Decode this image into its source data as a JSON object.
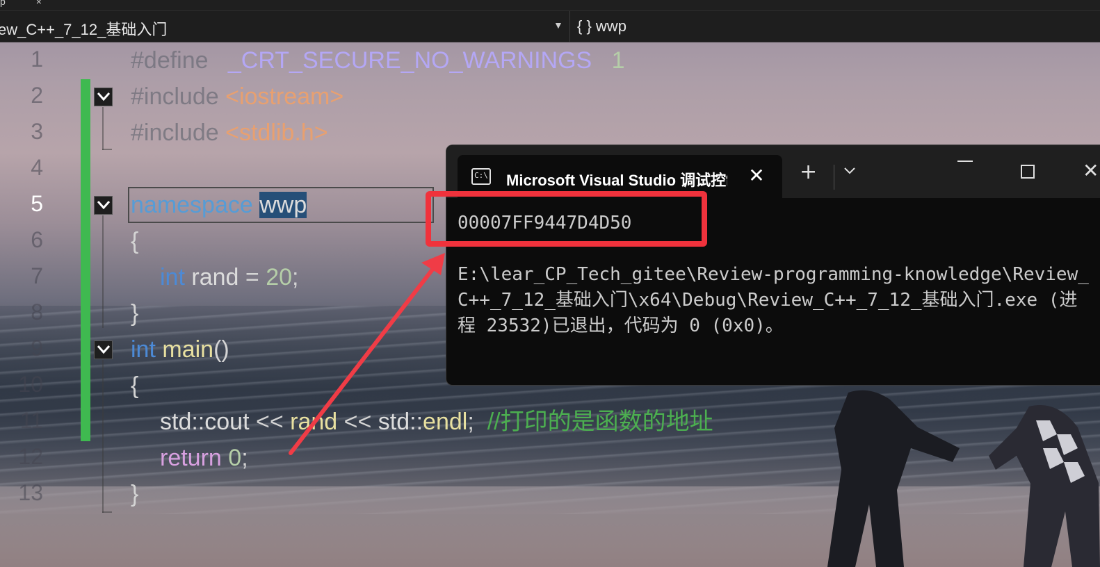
{
  "window": {
    "tab_fragment": "p",
    "tab_close": "×"
  },
  "navbar": {
    "project_dropdown": "ew_C++_7_12_基础入门",
    "scope": "{ } wwp"
  },
  "editor": {
    "line_numbers": [
      "1",
      "2",
      "3",
      "4",
      "5",
      "6",
      "7",
      "8",
      "9",
      "10",
      "11",
      "12",
      "13"
    ],
    "active_line": "5",
    "lines": {
      "l1": {
        "kw": "#define",
        "macro": "_CRT_SECURE_NO_WARNINGS",
        "num": "1"
      },
      "l2": {
        "kw": "#include",
        "lt": "<",
        "name": "iostream",
        "gt": ">"
      },
      "l3": {
        "kw": "#include",
        "lt": "<",
        "name": "stdlib.h",
        "gt": ">"
      },
      "l5": {
        "kw": "namespace",
        "name": "wwp"
      },
      "l6": {
        "text": "{"
      },
      "l7": {
        "type": "int",
        "name": "rand",
        "op": " = ",
        "num": "20",
        "end": ";"
      },
      "l8": {
        "text": "}"
      },
      "l9": {
        "type": "int",
        "fn": "main",
        "parens": "()"
      },
      "l10": {
        "text": "{"
      },
      "l11": {
        "ns": "std::",
        "cout": "cout",
        "op1": " << ",
        "var": "rand",
        "op2": " << ",
        "ns2": "std::",
        "endl": "endl",
        "end": ";",
        "comment": "//打印的是函数的地址"
      },
      "l12": {
        "kw": "return",
        "num": "0",
        "end": ";"
      },
      "l13": {
        "text": "}"
      }
    }
  },
  "terminal": {
    "icon": "C:\\",
    "title": "Microsoft Visual Studio 调试控制台",
    "tab_close": "✕",
    "new_tab": "+",
    "address_output": "00007FF9447D4D50",
    "exit_message": "E:\\lear_CP_Tech_gitee\\Review-programming-knowledge\\Review_C++_7_12_基础入门\\x64\\Debug\\Review_C++_7_12_基础入门.exe (进程 23532)已退出，代码为 0 (0x0)。"
  },
  "colors": {
    "highlight_box": "#f0323c",
    "change_bar": "#3fb950"
  }
}
